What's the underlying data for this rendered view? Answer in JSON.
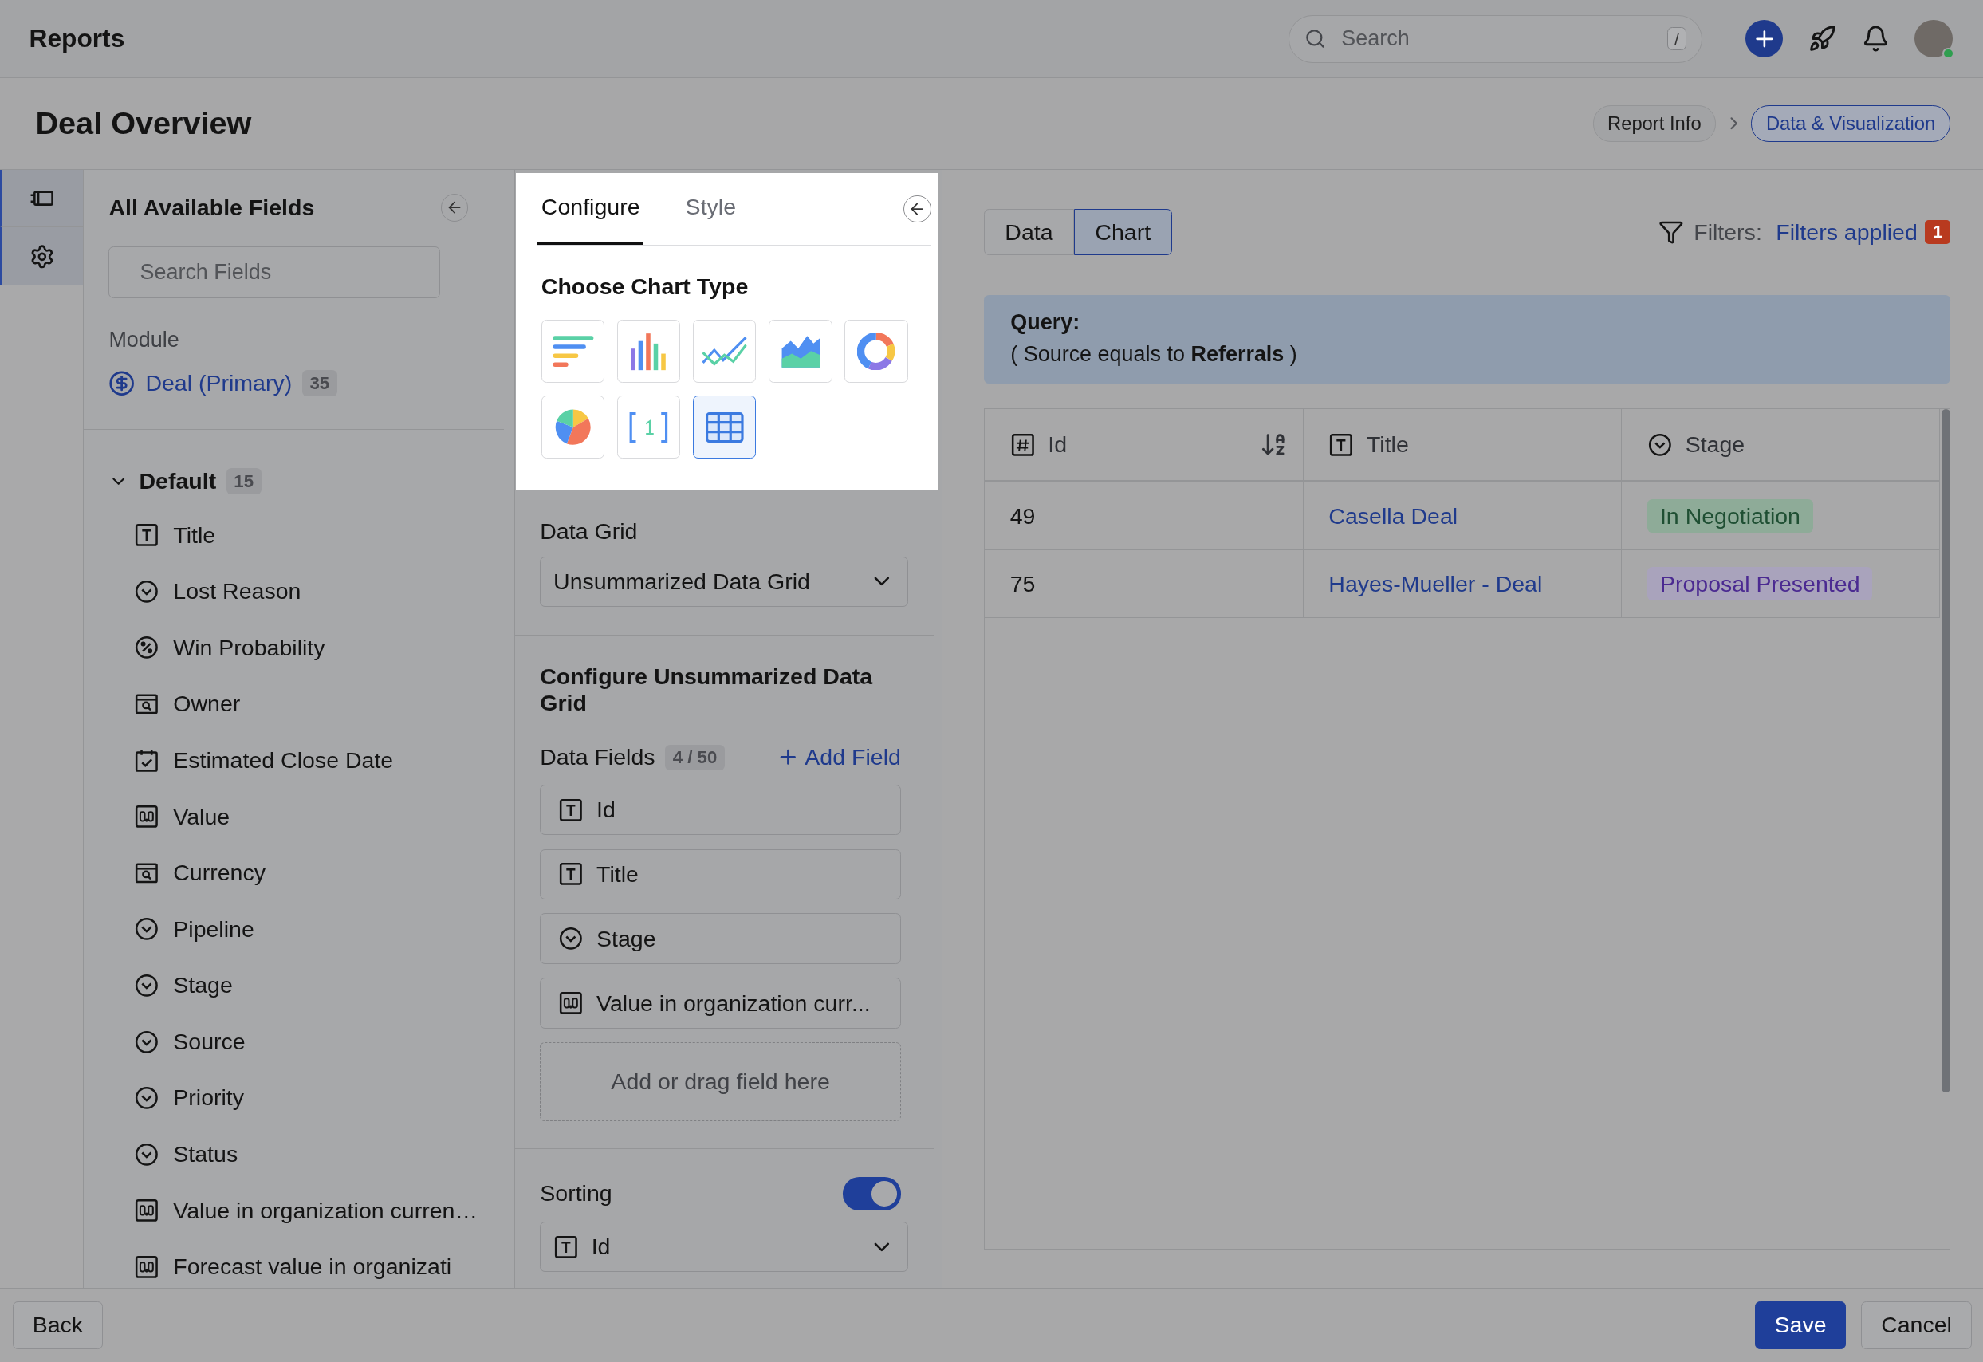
{
  "app": {
    "title": "Reports"
  },
  "search": {
    "placeholder": "Search",
    "shortcut": "/"
  },
  "page": {
    "title": "Deal Overview"
  },
  "breadcrumb": [
    {
      "label": "Report Info",
      "selected": false
    },
    {
      "label": "Data & Visualization",
      "selected": true
    }
  ],
  "fields_panel": {
    "title": "All Available Fields",
    "search_placeholder": "Search Fields",
    "module_label": "Module",
    "module": {
      "name": "Deal (Primary)",
      "count": "35"
    },
    "group": {
      "name": "Default",
      "count": "15",
      "expanded": true,
      "fields": [
        {
          "label": "Title",
          "kind": "text"
        },
        {
          "label": "Lost Reason",
          "kind": "select"
        },
        {
          "label": "Win Probability",
          "kind": "percent"
        },
        {
          "label": "Owner",
          "kind": "lookup"
        },
        {
          "label": "Estimated Close Date",
          "kind": "date"
        },
        {
          "label": "Value",
          "kind": "number"
        },
        {
          "label": "Currency",
          "kind": "lookup"
        },
        {
          "label": "Pipeline",
          "kind": "select"
        },
        {
          "label": "Stage",
          "kind": "select"
        },
        {
          "label": "Source",
          "kind": "select"
        },
        {
          "label": "Priority",
          "kind": "select"
        },
        {
          "label": "Status",
          "kind": "select"
        },
        {
          "label": "Value in organization curren…",
          "kind": "number"
        },
        {
          "label": "Forecast value in organizati",
          "kind": "number"
        }
      ]
    }
  },
  "config_panel": {
    "tabs": [
      {
        "label": "Configure",
        "selected": true
      },
      {
        "label": "Style",
        "selected": false
      }
    ],
    "chart_type_title": "Choose Chart Type",
    "chart_types": [
      {
        "kind": "hbar",
        "selected": false
      },
      {
        "kind": "vbar",
        "selected": false
      },
      {
        "kind": "line",
        "selected": false
      },
      {
        "kind": "area",
        "selected": false
      },
      {
        "kind": "donut",
        "selected": false
      },
      {
        "kind": "pie",
        "selected": false
      },
      {
        "kind": "number",
        "selected": false
      },
      {
        "kind": "table",
        "selected": true
      }
    ],
    "data_grid": {
      "label": "Data Grid",
      "value": "Unsummarized Data Grid"
    },
    "configure_title": "Configure Unsummarized Data Grid",
    "data_fields": {
      "label": "Data Fields",
      "count": "4 / 50",
      "add": "Add Field",
      "items": [
        {
          "label": "Id",
          "kind": "text"
        },
        {
          "label": "Title",
          "kind": "text"
        },
        {
          "label": "Stage",
          "kind": "select"
        },
        {
          "label": "Value in organization curr...",
          "kind": "number"
        }
      ],
      "drop_hint": "Add or drag field here"
    },
    "sorting": {
      "label": "Sorting",
      "on": true,
      "field": {
        "label": "Id",
        "kind": "text"
      }
    }
  },
  "view_tabs": [
    {
      "label": "Data",
      "selected": false
    },
    {
      "label": "Chart",
      "selected": true
    }
  ],
  "filters": {
    "label": "Filters:",
    "link": "Filters applied",
    "count": "1"
  },
  "query": {
    "title": "Query:",
    "text": "( Source equals to **Referrals** )"
  },
  "table": {
    "columns": [
      {
        "label": "Id",
        "kind": "hash",
        "sorted": true
      },
      {
        "label": "Title",
        "kind": "text",
        "sorted": false
      },
      {
        "label": "Stage",
        "kind": "select",
        "sorted": false
      }
    ],
    "rows": [
      {
        "id": "49",
        "title": "Casella Deal",
        "stage": {
          "label": "In Negotiation",
          "color": "#8eab98"
        }
      },
      {
        "id": "75",
        "title": "Hayes-Mueller - Deal",
        "stage": {
          "label": "Proposal Presented",
          "color": "#a9a3bc"
        }
      }
    ]
  },
  "footer": {
    "back": "Back",
    "save": "Save",
    "cancel": "Cancel"
  }
}
